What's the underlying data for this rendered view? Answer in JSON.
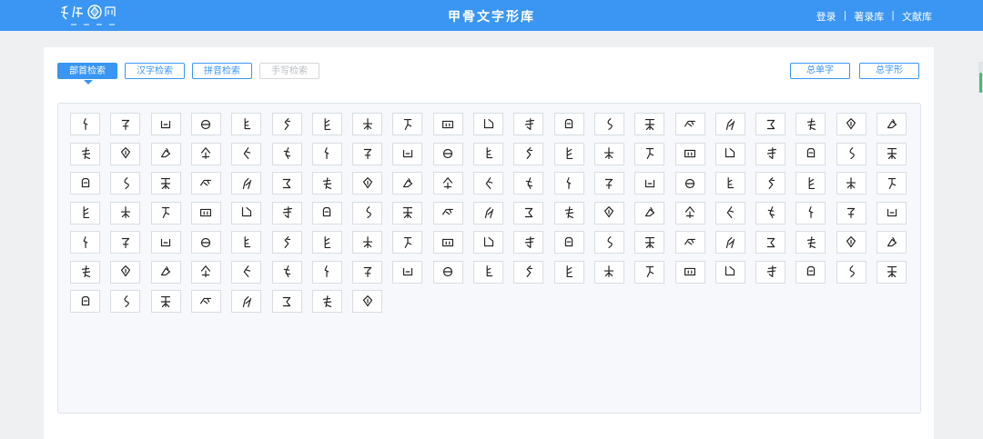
{
  "header": {
    "title": "甲骨文字形库",
    "links": [
      "登录",
      "著录库",
      "文献库"
    ],
    "separator": "|"
  },
  "tabs": [
    {
      "label": "部首检索",
      "state": "active"
    },
    {
      "label": "汉字检索",
      "state": "normal"
    },
    {
      "label": "拼音检索",
      "state": "normal"
    },
    {
      "label": "手写检索",
      "state": "disabled"
    }
  ],
  "right_buttons": [
    "总单字",
    "总字形"
  ],
  "radicals": {
    "count": 134,
    "columns": 21,
    "glyph_variants": 24
  },
  "colors": {
    "header_bg": "#3a96f2",
    "accent": "#3a96f2",
    "scroll_thumb": "#3ec06a"
  }
}
